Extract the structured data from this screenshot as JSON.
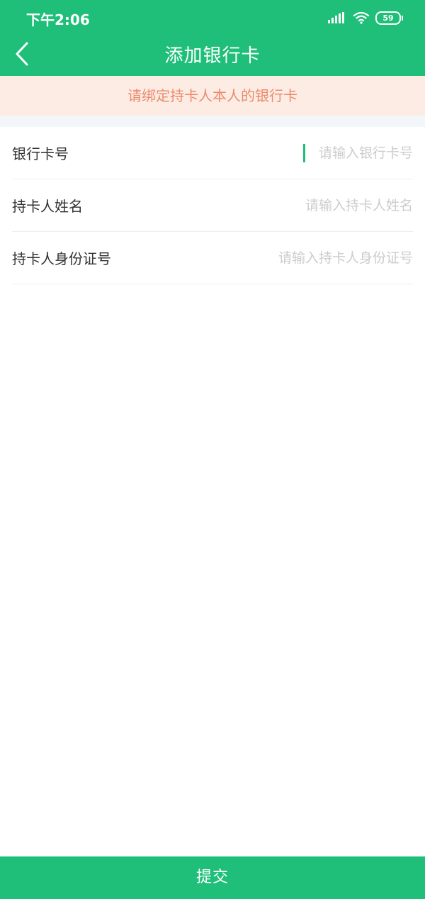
{
  "status_bar": {
    "time": "下午2:06",
    "battery_level": "59"
  },
  "header": {
    "title": "添加银行卡",
    "back_icon": "chevron-left-icon"
  },
  "notice": {
    "text": "请绑定持卡人本人的银行卡"
  },
  "form": {
    "fields": [
      {
        "label": "银行卡号",
        "placeholder": "请输入银行卡号",
        "value": ""
      },
      {
        "label": "持卡人姓名",
        "placeholder": "请输入持卡人姓名",
        "value": ""
      },
      {
        "label": "持卡人身份证号",
        "placeholder": "请输入持卡人身份证号",
        "value": ""
      }
    ]
  },
  "submit": {
    "label": "提交"
  },
  "colors": {
    "brand": "#1fbf7a",
    "notice_bg": "#fdece4",
    "notice_text": "#ec8a6b"
  }
}
